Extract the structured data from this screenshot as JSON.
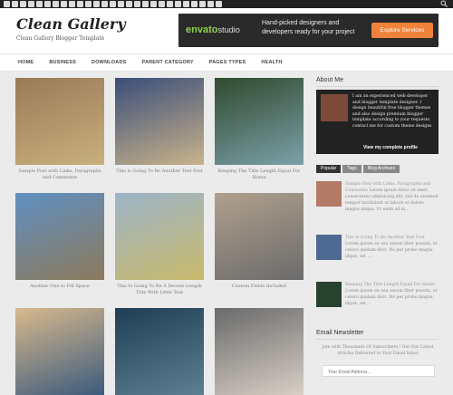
{
  "header": {
    "logo": "Clean Gallery",
    "tagline": "Clean Gallery Blogger Template"
  },
  "ad": {
    "brand": "envato",
    "brand_suffix": "studio",
    "text": "Hand-picked designers and developers ready for your project",
    "button": "Explore Services"
  },
  "nav": [
    "HOME",
    "BUSINESS",
    "DOWNLOADS",
    "PARENT CATEGORY",
    "PAGES TYPES",
    "HEALTH"
  ],
  "posts": [
    {
      "caption": "Sample Post with Links, Paragraphs and Comments",
      "colors": [
        "#9a7a58",
        "#c9b07d"
      ]
    },
    {
      "caption": "This is Going To Be Another Text Post",
      "colors": [
        "#3a4e7a",
        "#c9b38a"
      ]
    },
    {
      "caption": "Keeping The Title Length Equal For Home",
      "colors": [
        "#2f4a2e",
        "#7ba0a8"
      ]
    },
    {
      "caption": "Another One to Fill Space",
      "colors": [
        "#5f8fc2",
        "#8c7a5b"
      ]
    },
    {
      "caption": "This Is Going To Be A Decent Length Title With Little Text",
      "colors": [
        "#9db4c9",
        "#c8b96a"
      ]
    },
    {
      "caption": "Custom Fields Included",
      "colors": [
        "#b0a08d",
        "#6b6b6b"
      ]
    },
    {
      "caption": "",
      "colors": [
        "#d8b98c",
        "#3c5b7d"
      ]
    },
    {
      "caption": "",
      "colors": [
        "#1f3e55",
        "#5d7f93"
      ]
    },
    {
      "caption": "",
      "colors": [
        "#6a6a6a",
        "#d8cfc6"
      ]
    }
  ],
  "sidebar": {
    "about_title": "About Me",
    "about_text": "I am an experienced web developer and blogger template designer. I design beautiful free blogger themes and also design premium blogger template according to your requests. contact me for custom theme designs",
    "about_link": "View my complete profile",
    "tabs": [
      "Popular",
      "Tags",
      "Blog Archives"
    ],
    "items": [
      {
        "title": "Sample Post with Links, Paragraphs and Comments",
        "text": "Lorem ipsum dolor sit amet, consectetur adipisicing elit, sed do eiusmod tempor incididunt ut labore et dolore magna aliqua. Ut enim ad m...",
        "color": "#b37a68"
      },
      {
        "title": "This is Going To Be Another Text Post",
        "text": "Lorem ipsum eu usu assum liber possim, ut cetero quidam dicit. Ne per probo magna idque, est ...",
        "color": "#4f6a92"
      },
      {
        "title": "Keeping The Title Length Equal For Home",
        "text": "Lorem ipsum eu usu assum liber possim, ut cetero quidam dicit. Ne per probo magna idque, est ...",
        "color": "#29422f"
      }
    ],
    "newsletter_title": "Email Newsletter",
    "newsletter_text": "Join with Thousands Of Subscribers ! Get Our Latest Articles Delivered to Your Email Inbox",
    "email_placeholder": "Your Email Address..."
  }
}
